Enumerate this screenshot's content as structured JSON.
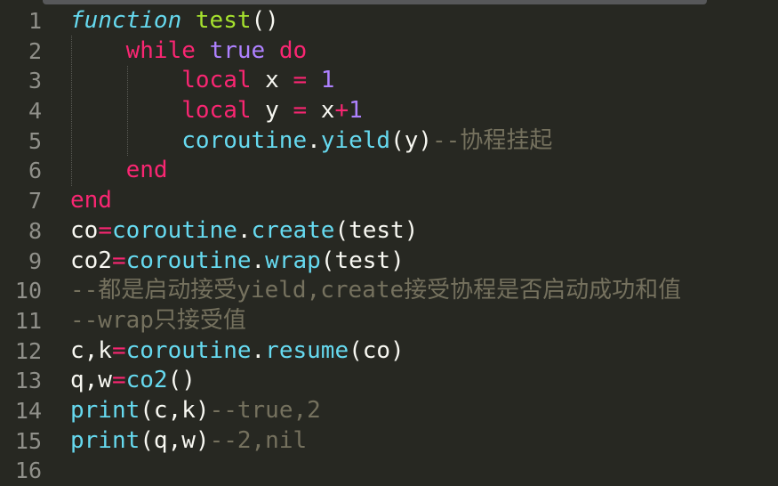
{
  "editor": {
    "theme_colors": {
      "background": "#272822",
      "keyword": "#f92672",
      "builtin": "#66d9ef",
      "function_name": "#a6e22e",
      "number": "#ae81ff",
      "comment": "#75715e",
      "text": "#f8f8f2"
    },
    "lines": [
      {
        "n": "1",
        "tokens": [
          [
            "function",
            "fn it"
          ],
          [
            " ",
            ""
          ],
          [
            "test",
            "nm"
          ],
          [
            "()",
            ""
          ]
        ]
      },
      {
        "n": "2",
        "tokens": [
          [
            "    ",
            ""
          ],
          [
            "while",
            "kw"
          ],
          [
            " ",
            ""
          ],
          [
            "true",
            "num"
          ],
          [
            " ",
            ""
          ],
          [
            "do",
            "kw"
          ]
        ]
      },
      {
        "n": "3",
        "tokens": [
          [
            "        ",
            ""
          ],
          [
            "local",
            "kw"
          ],
          [
            " x ",
            ""
          ],
          [
            "=",
            "op"
          ],
          [
            " ",
            ""
          ],
          [
            "1",
            "num"
          ]
        ]
      },
      {
        "n": "4",
        "tokens": [
          [
            "        ",
            ""
          ],
          [
            "local",
            "kw"
          ],
          [
            " y ",
            ""
          ],
          [
            "=",
            "op"
          ],
          [
            " x",
            ""
          ],
          [
            "+",
            "op"
          ],
          [
            "1",
            "num"
          ]
        ]
      },
      {
        "n": "5",
        "tokens": [
          [
            "        ",
            ""
          ],
          [
            "coroutine",
            "fn"
          ],
          [
            ".",
            ""
          ],
          [
            "yield",
            "fn"
          ],
          [
            "(y)",
            ""
          ],
          [
            "--协程挂起",
            "cm"
          ]
        ]
      },
      {
        "n": "6",
        "tokens": [
          [
            "    ",
            ""
          ],
          [
            "end",
            "kw"
          ]
        ]
      },
      {
        "n": "7",
        "tokens": [
          [
            "end",
            "kw"
          ]
        ]
      },
      {
        "n": "8",
        "tokens": [
          [
            "co",
            ""
          ],
          [
            "=",
            "op"
          ],
          [
            "coroutine",
            "fn"
          ],
          [
            ".",
            ""
          ],
          [
            "create",
            "fn"
          ],
          [
            "(test)",
            ""
          ]
        ]
      },
      {
        "n": "9",
        "tokens": [
          [
            "co2",
            ""
          ],
          [
            "=",
            "op"
          ],
          [
            "coroutine",
            "fn"
          ],
          [
            ".",
            ""
          ],
          [
            "wrap",
            "fn"
          ],
          [
            "(test)",
            ""
          ]
        ]
      },
      {
        "n": "10",
        "tokens": [
          [
            "--都是启动接受yield,create接受协程是否启动成功和值",
            "cm"
          ]
        ]
      },
      {
        "n": "11",
        "tokens": [
          [
            "--wrap只接受值",
            "cm"
          ]
        ]
      },
      {
        "n": "12",
        "tokens": [
          [
            "c,k",
            ""
          ],
          [
            "=",
            "op"
          ],
          [
            "coroutine",
            "fn"
          ],
          [
            ".",
            ""
          ],
          [
            "resume",
            "fn"
          ],
          [
            "(co)",
            ""
          ]
        ]
      },
      {
        "n": "13",
        "tokens": [
          [
            "q,w",
            ""
          ],
          [
            "=",
            "op"
          ],
          [
            "co2",
            "fn"
          ],
          [
            "()",
            ""
          ]
        ]
      },
      {
        "n": "14",
        "tokens": [
          [
            "print",
            "fn"
          ],
          [
            "(c,k)",
            ""
          ],
          [
            "--true,2",
            "cm"
          ]
        ]
      },
      {
        "n": "15",
        "tokens": [
          [
            "print",
            "fn"
          ],
          [
            "(q,w)",
            ""
          ],
          [
            "--2,nil",
            "cm"
          ]
        ]
      },
      {
        "n": "16",
        "tokens": []
      }
    ]
  }
}
